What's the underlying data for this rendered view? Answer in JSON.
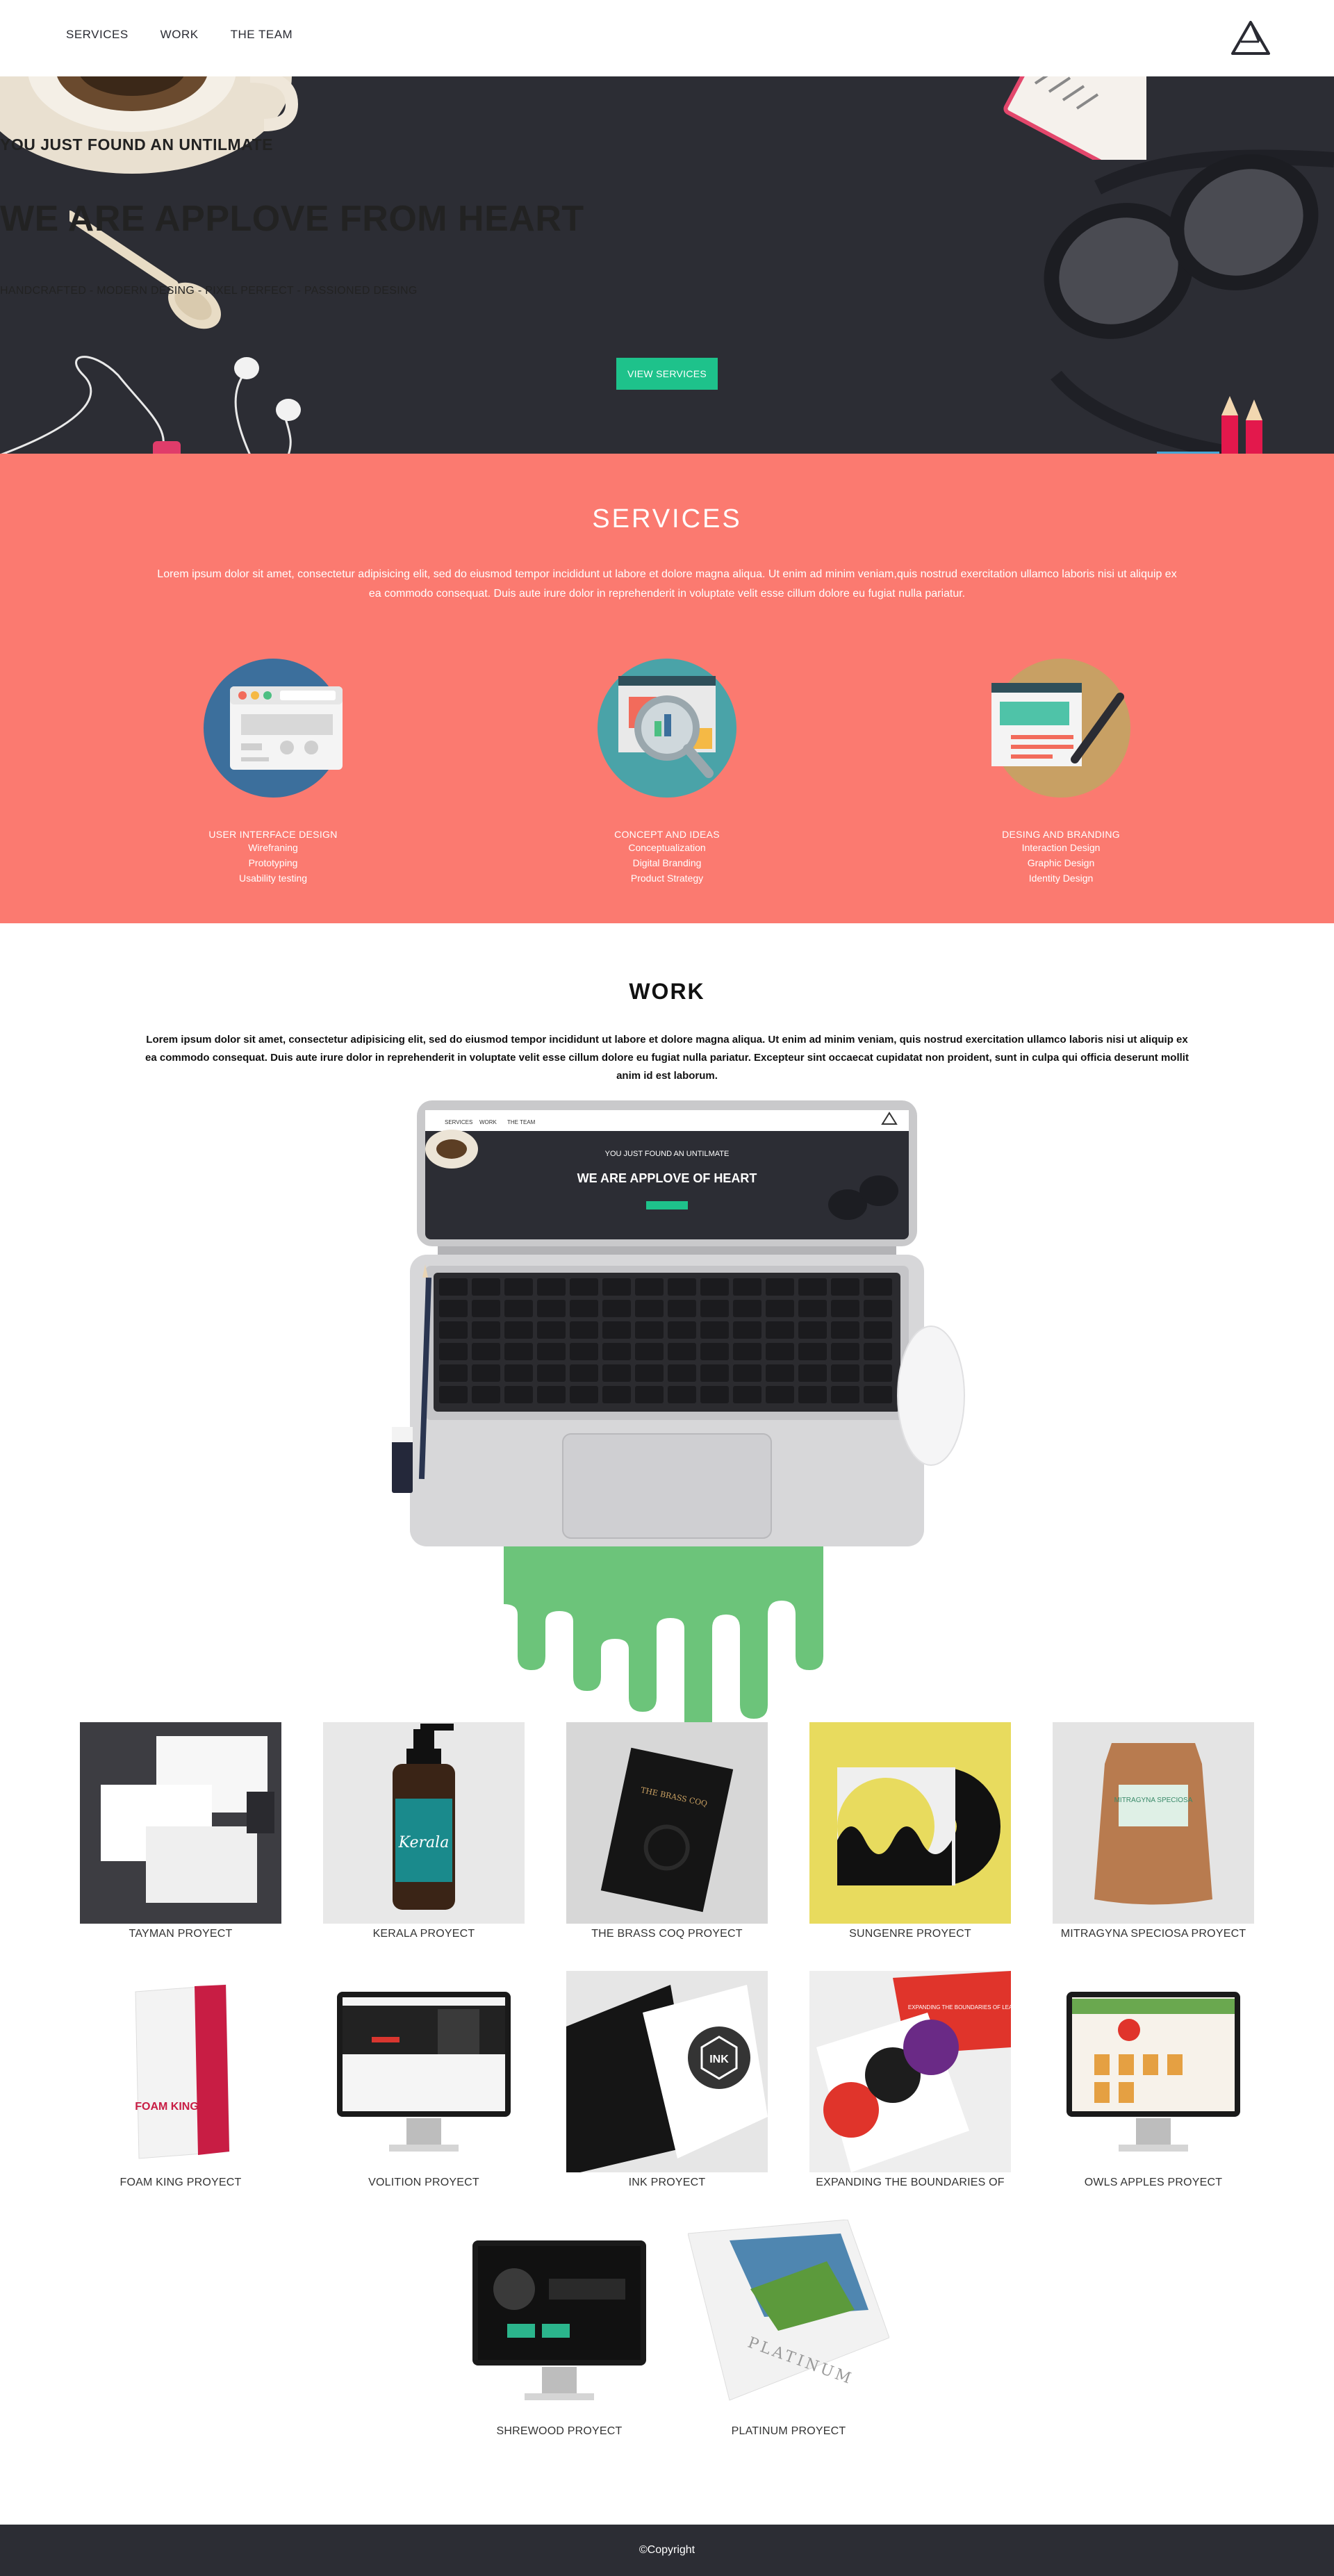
{
  "nav": {
    "links": [
      "SERVICES",
      "WORK",
      "THE TEAM"
    ],
    "logo_icon": "triangle-logo-icon"
  },
  "hero": {
    "kicker": "YOU JUST FOUND AN UNTILMATE",
    "title": "WE ARE APPLOVE FROM HEART",
    "subtitle": "HANDCRAFTED - MODERN DESING - PIXEL PERFECT - PASSIONED DESING",
    "button": "VIEW SERVICES"
  },
  "services": {
    "title": "SERVICES",
    "text": "Lorem ipsum dolor sit amet, consectetur adipisicing elit, sed do eiusmod tempor incididunt ut labore et dolore magna aliqua. Ut enim ad minim veniam,quis nostrud exercitation ullamco laboris nisi ut aliquip ex ea commodo consequat. Duis aute irure dolor in reprehenderit in voluptate velit esse cillum dolore eu fugiat nulla pariatur.",
    "items": [
      {
        "name": "USER INTERFACE DESIGN",
        "items": [
          "Wirefraning",
          "Prototyping",
          "Usability testing"
        ]
      },
      {
        "name": "CONCEPT AND IDEAS",
        "items": [
          "Conceptualization",
          "Digital Branding",
          "Product Strategy"
        ]
      },
      {
        "name": "DESING AND BRANDING",
        "items": [
          "Interaction Design",
          "Graphic Design",
          "Identity Design"
        ]
      }
    ]
  },
  "work": {
    "title": "WORK",
    "text": "Lorem ipsum dolor sit amet, consectetur adipisicing elit, sed do eiusmod tempor incididunt ut labore et dolore magna aliqua. Ut enim ad minim veniam, quis nostrud exercitation ullamco laboris nisi ut aliquip ex ea commodo consequat. Duis aute irure dolor in reprehenderit in voluptate velit esse cillum dolore eu fugiat nulla pariatur. Excepteur sint occaecat cupidatat non proident, sunt in culpa qui officia deserunt mollit anim id est laborum.",
    "laptop_screen": {
      "nav": [
        "SERVICES",
        "WORK",
        "THE TEAM"
      ],
      "kicker": "YOU JUST FOUND AN UNTILMATE",
      "title": "WE ARE APPLOVE OF HEART"
    },
    "projects": [
      "TAYMAN PROYECT",
      "KERALA PROYECT",
      "THE BRASS COQ PROYECT",
      "SUNGENRE PROYECT",
      "MITRAGYNA SPECIOSA PROYECT",
      "FOAM KING PROYECT",
      "VOLITION PROYECT",
      "INK PROYECT",
      "EXPANDING THE BOUNDARIES OF",
      "OWLS APPLES PROYECT",
      "SHREWOOD PROYECT",
      "PLATINUM PROYECT"
    ],
    "project_art": {
      "kerala_bottle": "Kerala",
      "brass_coq": "THE BRASS COQ",
      "foam_king": "FOAM KING",
      "ink": "INK",
      "expanding": "EXPANDING THE BOUNDARIES OF LEARNING",
      "mitragyna": "MITRAGYNA SPECIOSA",
      "platinum": "PLATINUM"
    }
  },
  "footer": {
    "copyright": "©Copyright"
  },
  "colors": {
    "dark": "#2c2d34",
    "coral": "#fb7a70",
    "green": "#1ec28b",
    "slime": "#6cc47a"
  }
}
